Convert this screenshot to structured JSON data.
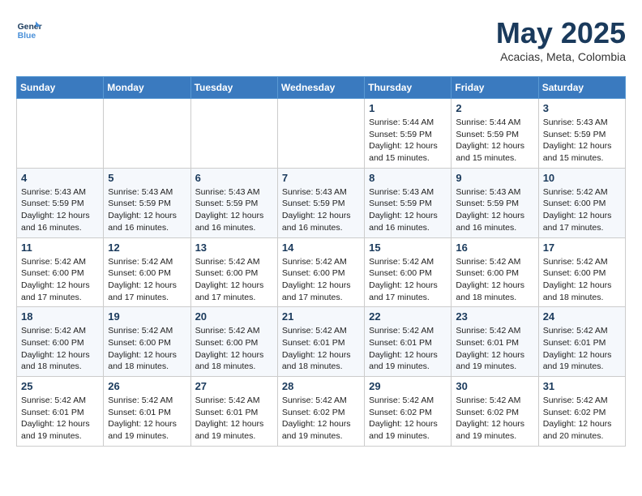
{
  "header": {
    "logo_line1": "General",
    "logo_line2": "Blue",
    "month_title": "May 2025",
    "location": "Acacias, Meta, Colombia"
  },
  "days_of_week": [
    "Sunday",
    "Monday",
    "Tuesday",
    "Wednesday",
    "Thursday",
    "Friday",
    "Saturday"
  ],
  "weeks": [
    [
      {
        "day": "",
        "info": ""
      },
      {
        "day": "",
        "info": ""
      },
      {
        "day": "",
        "info": ""
      },
      {
        "day": "",
        "info": ""
      },
      {
        "day": "1",
        "info": "Sunrise: 5:44 AM\nSunset: 5:59 PM\nDaylight: 12 hours\nand 15 minutes."
      },
      {
        "day": "2",
        "info": "Sunrise: 5:44 AM\nSunset: 5:59 PM\nDaylight: 12 hours\nand 15 minutes."
      },
      {
        "day": "3",
        "info": "Sunrise: 5:43 AM\nSunset: 5:59 PM\nDaylight: 12 hours\nand 15 minutes."
      }
    ],
    [
      {
        "day": "4",
        "info": "Sunrise: 5:43 AM\nSunset: 5:59 PM\nDaylight: 12 hours\nand 16 minutes."
      },
      {
        "day": "5",
        "info": "Sunrise: 5:43 AM\nSunset: 5:59 PM\nDaylight: 12 hours\nand 16 minutes."
      },
      {
        "day": "6",
        "info": "Sunrise: 5:43 AM\nSunset: 5:59 PM\nDaylight: 12 hours\nand 16 minutes."
      },
      {
        "day": "7",
        "info": "Sunrise: 5:43 AM\nSunset: 5:59 PM\nDaylight: 12 hours\nand 16 minutes."
      },
      {
        "day": "8",
        "info": "Sunrise: 5:43 AM\nSunset: 5:59 PM\nDaylight: 12 hours\nand 16 minutes."
      },
      {
        "day": "9",
        "info": "Sunrise: 5:43 AM\nSunset: 5:59 PM\nDaylight: 12 hours\nand 16 minutes."
      },
      {
        "day": "10",
        "info": "Sunrise: 5:42 AM\nSunset: 6:00 PM\nDaylight: 12 hours\nand 17 minutes."
      }
    ],
    [
      {
        "day": "11",
        "info": "Sunrise: 5:42 AM\nSunset: 6:00 PM\nDaylight: 12 hours\nand 17 minutes."
      },
      {
        "day": "12",
        "info": "Sunrise: 5:42 AM\nSunset: 6:00 PM\nDaylight: 12 hours\nand 17 minutes."
      },
      {
        "day": "13",
        "info": "Sunrise: 5:42 AM\nSunset: 6:00 PM\nDaylight: 12 hours\nand 17 minutes."
      },
      {
        "day": "14",
        "info": "Sunrise: 5:42 AM\nSunset: 6:00 PM\nDaylight: 12 hours\nand 17 minutes."
      },
      {
        "day": "15",
        "info": "Sunrise: 5:42 AM\nSunset: 6:00 PM\nDaylight: 12 hours\nand 17 minutes."
      },
      {
        "day": "16",
        "info": "Sunrise: 5:42 AM\nSunset: 6:00 PM\nDaylight: 12 hours\nand 18 minutes."
      },
      {
        "day": "17",
        "info": "Sunrise: 5:42 AM\nSunset: 6:00 PM\nDaylight: 12 hours\nand 18 minutes."
      }
    ],
    [
      {
        "day": "18",
        "info": "Sunrise: 5:42 AM\nSunset: 6:00 PM\nDaylight: 12 hours\nand 18 minutes."
      },
      {
        "day": "19",
        "info": "Sunrise: 5:42 AM\nSunset: 6:00 PM\nDaylight: 12 hours\nand 18 minutes."
      },
      {
        "day": "20",
        "info": "Sunrise: 5:42 AM\nSunset: 6:00 PM\nDaylight: 12 hours\nand 18 minutes."
      },
      {
        "day": "21",
        "info": "Sunrise: 5:42 AM\nSunset: 6:01 PM\nDaylight: 12 hours\nand 18 minutes."
      },
      {
        "day": "22",
        "info": "Sunrise: 5:42 AM\nSunset: 6:01 PM\nDaylight: 12 hours\nand 19 minutes."
      },
      {
        "day": "23",
        "info": "Sunrise: 5:42 AM\nSunset: 6:01 PM\nDaylight: 12 hours\nand 19 minutes."
      },
      {
        "day": "24",
        "info": "Sunrise: 5:42 AM\nSunset: 6:01 PM\nDaylight: 12 hours\nand 19 minutes."
      }
    ],
    [
      {
        "day": "25",
        "info": "Sunrise: 5:42 AM\nSunset: 6:01 PM\nDaylight: 12 hours\nand 19 minutes."
      },
      {
        "day": "26",
        "info": "Sunrise: 5:42 AM\nSunset: 6:01 PM\nDaylight: 12 hours\nand 19 minutes."
      },
      {
        "day": "27",
        "info": "Sunrise: 5:42 AM\nSunset: 6:01 PM\nDaylight: 12 hours\nand 19 minutes."
      },
      {
        "day": "28",
        "info": "Sunrise: 5:42 AM\nSunset: 6:02 PM\nDaylight: 12 hours\nand 19 minutes."
      },
      {
        "day": "29",
        "info": "Sunrise: 5:42 AM\nSunset: 6:02 PM\nDaylight: 12 hours\nand 19 minutes."
      },
      {
        "day": "30",
        "info": "Sunrise: 5:42 AM\nSunset: 6:02 PM\nDaylight: 12 hours\nand 19 minutes."
      },
      {
        "day": "31",
        "info": "Sunrise: 5:42 AM\nSunset: 6:02 PM\nDaylight: 12 hours\nand 20 minutes."
      }
    ]
  ]
}
